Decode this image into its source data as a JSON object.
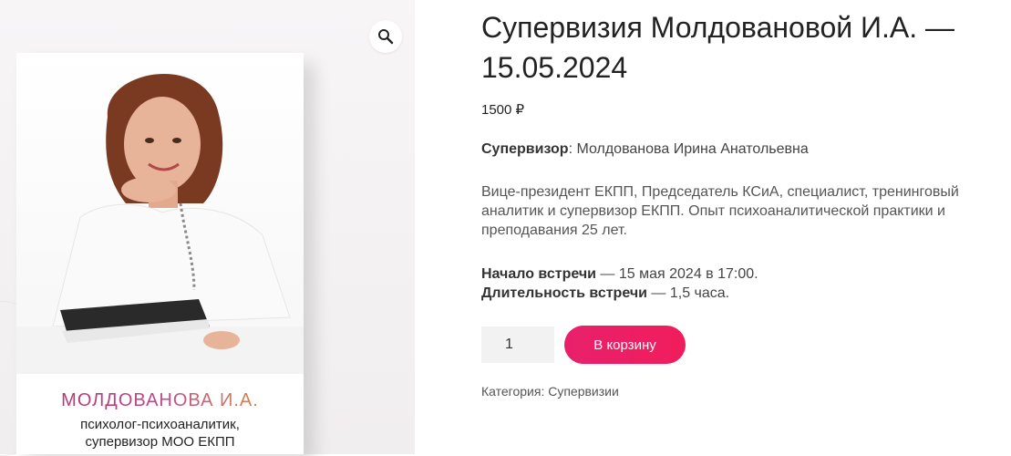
{
  "product": {
    "title": "Супервизия Молдовановой И.А. — 15.05.2024",
    "price": "1500 ₽",
    "supervisor_label": "Супервизор",
    "supervisor_value": ": Молдованова Ирина Анатольевна",
    "description": "Вице-президент ЕКПП, Председатель КСиА, специалист, тренинговый аналитик и супервизор ЕКПП. Опыт психоаналитической практики и преподавания 25 лет.",
    "meeting_start_label": "Начало встречи",
    "meeting_start_value": " — 15 мая 2024 в 17:00.",
    "duration_label": "Длительность встречи",
    "duration_value": " — 1,5 часа.",
    "quantity": "1",
    "add_to_cart": "В корзину",
    "category_label": "Категория: ",
    "category_link": "Супервизии"
  },
  "image_card": {
    "name": "МОЛДОВАНОВА И.А.",
    "subtitle_line1": "психолог-психоаналитик,",
    "subtitle_line2": "супервизор МОО ЕКПП"
  },
  "icons": {
    "zoom": "search-icon"
  },
  "colors": {
    "accent": "#ee1f63",
    "name_gradient_start": "#b0306a",
    "name_gradient_end": "#e0a23a"
  }
}
